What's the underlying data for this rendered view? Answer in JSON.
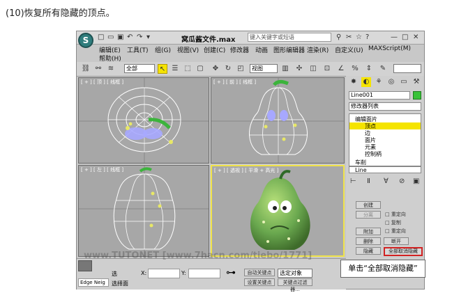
{
  "caption": "(10)恢复所有隐藏的顶点。",
  "window": {
    "title": "窝瓜酱文件.max",
    "search_placeholder": "键入关键字或短语"
  },
  "menu": [
    "编辑(E)",
    "工具(T)",
    "组(G)",
    "视图(V)",
    "创建(C)",
    "修改器",
    "动画",
    "图形编辑器",
    "渲染(R)",
    "自定义(U)",
    "MAXScript(M)",
    "帮助(H)"
  ],
  "toolbar": {
    "filter_select": "全部",
    "view_select": "视图"
  },
  "viewports": [
    {
      "label": "[ + ] [ 顶 ] [ 线框 ]"
    },
    {
      "label": "[ + ] [ 前 ] [ 线框 ]"
    },
    {
      "label": "[ + ] [ 左 ] [ 线框 ]"
    },
    {
      "label": "[ + ] [ 透视 ] [ 平滑 + 高光 ]"
    }
  ],
  "panel": {
    "object_name": "Line001",
    "modifier_list": "修改器列表",
    "stack": [
      "编辑面片",
      "顶点",
      "边",
      "面片",
      "元素",
      "控制柄",
      "车削",
      "Line"
    ],
    "section_title": "",
    "buttons": {
      "create": "创建",
      "detach": "分离",
      "reorient": "重定向",
      "copy": "复制",
      "attach": "附加",
      "reorient2": "重定向",
      "delete": "删除",
      "break": "断开",
      "hide": "隐藏",
      "unhide_all": "全部取消隐藏"
    }
  },
  "status": {
    "select_label": "选",
    "select_text": "选择面",
    "edge_label": "Edge Neig",
    "x_label": "X:",
    "y_label": "Y:",
    "auto_key": "自动关键点",
    "set_key_select": "选定对象",
    "set_key": "设置关键点",
    "key_filter": "关键点过滤器..."
  },
  "callout": "单击“全部取消隐藏”",
  "watermark": "www.TUTONET  [www.7hacn.com/tiebo/1771]",
  "colors": {
    "highlight": "#f5e400",
    "mesh": "#ffffff",
    "vertex": "#4466ff",
    "model_green": "#6aa84f",
    "callout_border": "#d22222"
  }
}
